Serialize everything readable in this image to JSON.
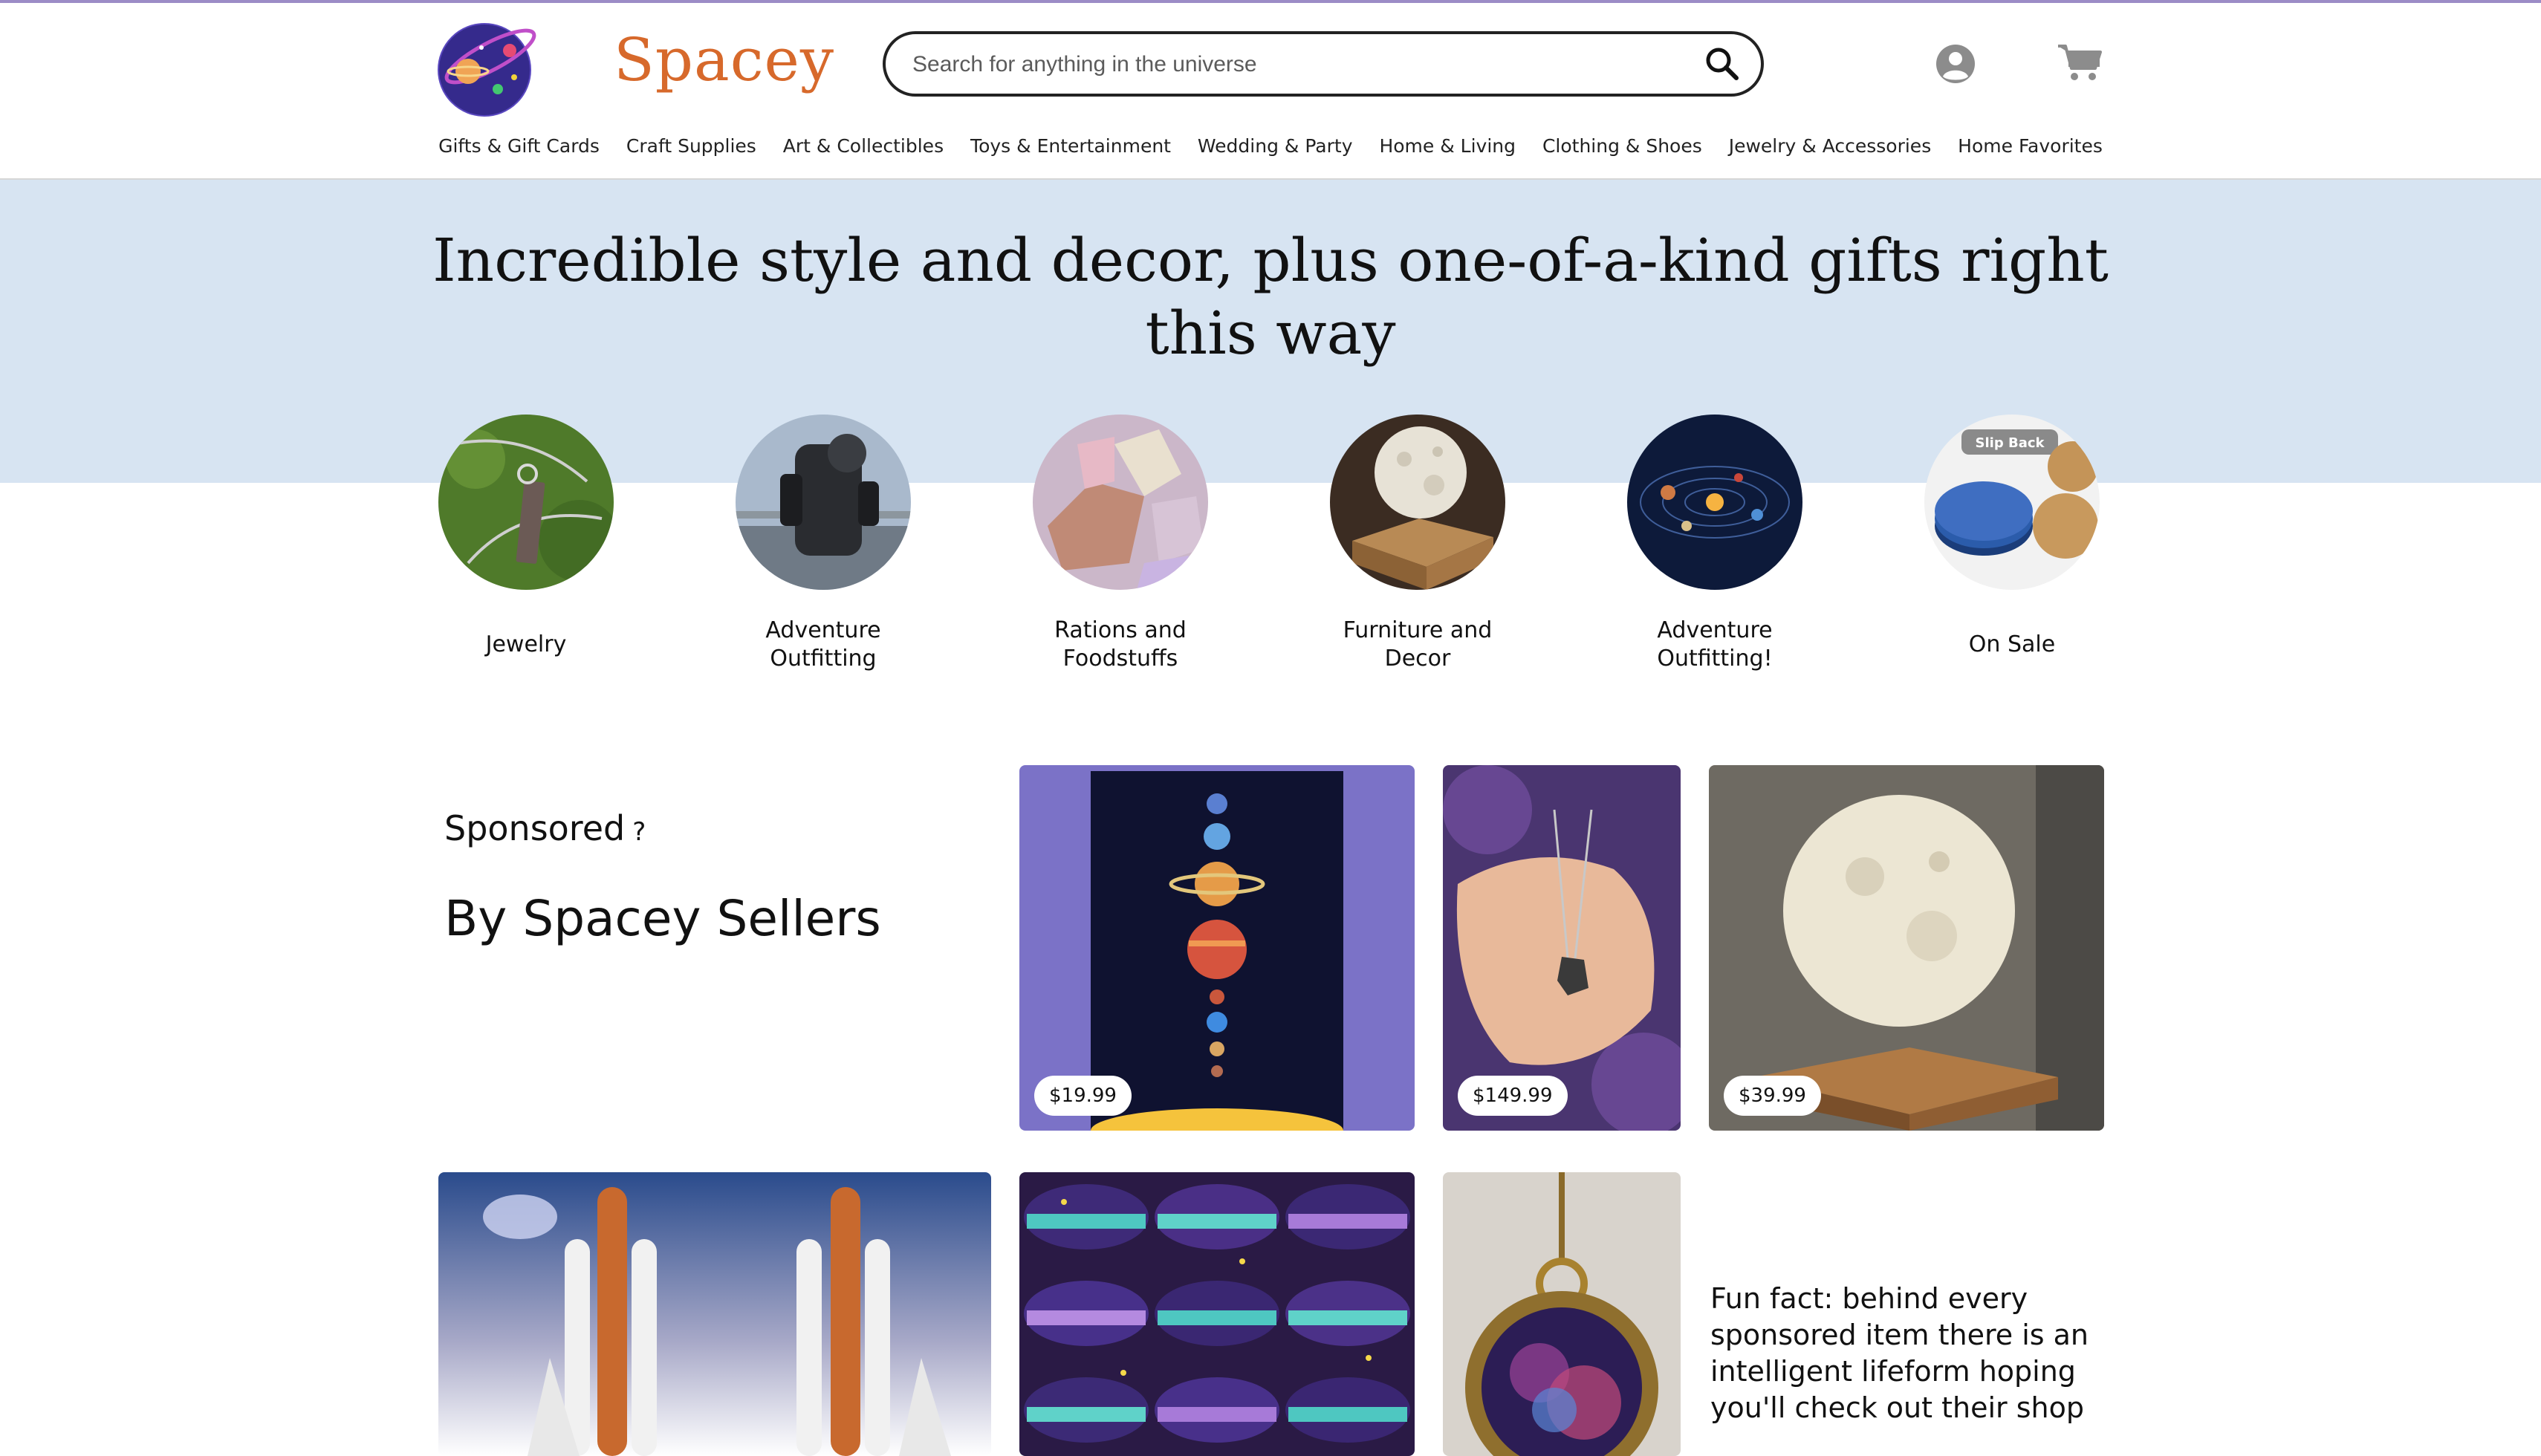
{
  "header": {
    "brand": "Spacey",
    "search_placeholder": "Search for anything in the universe",
    "logo_icon": "planet-logo-icon",
    "account_icon": "account-icon",
    "cart_icon": "cart-icon",
    "search_icon": "search-icon"
  },
  "nav": [
    "Gifts & Gift Cards",
    "Craft Supplies",
    "Art & Collectibles",
    "Toys & Entertainment",
    "Wedding & Party",
    "Home & Living",
    "Clothing & Shoes",
    "Jewelry & Accessories",
    "Home Favorites"
  ],
  "hero": {
    "title": "Incredible style and decor, plus one-of-a-kind gifts right this way"
  },
  "categories": [
    {
      "label": "Jewelry"
    },
    {
      "label": "Adventure Outfitting"
    },
    {
      "label": "Rations and Foodstuffs"
    },
    {
      "label": "Furniture and Decor"
    },
    {
      "label": "Adventure Outfitting!"
    },
    {
      "label": "On Sale"
    }
  ],
  "coaster_tag": "Slip Back",
  "sponsored": {
    "label": "Sponsored",
    "help": "?",
    "heading": "By Spacey Sellers"
  },
  "products": [
    {
      "price": "$19.99"
    },
    {
      "price": "$149.99"
    },
    {
      "price": "$39.99"
    }
  ],
  "fun_fact": "Fun fact: behind every sponsored item there is an intelligent lifeform hoping you'll check out their shop",
  "colors": {
    "brand": "#d7692b",
    "hero_bg": "#d7e4f2",
    "top_accent": "#9c8cc6"
  }
}
